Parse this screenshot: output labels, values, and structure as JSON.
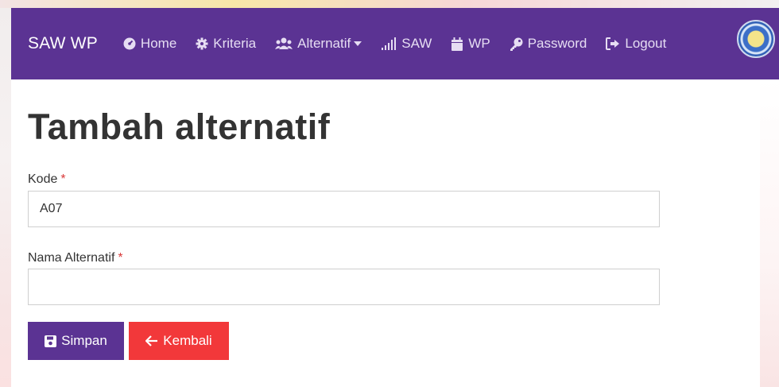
{
  "navbar": {
    "brand": "SAW WP",
    "items": [
      {
        "label": "Home",
        "icon": "dashboard-icon"
      },
      {
        "label": "Kriteria",
        "icon": "gear-icon"
      },
      {
        "label": "Alternatif",
        "icon": "users-icon"
      },
      {
        "label": "SAW",
        "icon": "signal-icon"
      },
      {
        "label": "WP",
        "icon": "calendar-icon"
      },
      {
        "label": "Password",
        "icon": "key-icon"
      },
      {
        "label": "Logout",
        "icon": "sign-out-icon"
      }
    ]
  },
  "page": {
    "title": "Tambah alternatif"
  },
  "form": {
    "kode_label": "Kode",
    "kode_value": "A07",
    "nama_label": "Nama Alternatif",
    "nama_value": "",
    "required_mark": "*",
    "save_label": "Simpan",
    "back_label": "Kembali"
  },
  "colors": {
    "navbar": "#5b3393",
    "primary": "#5b3393",
    "danger": "#f2383a"
  }
}
